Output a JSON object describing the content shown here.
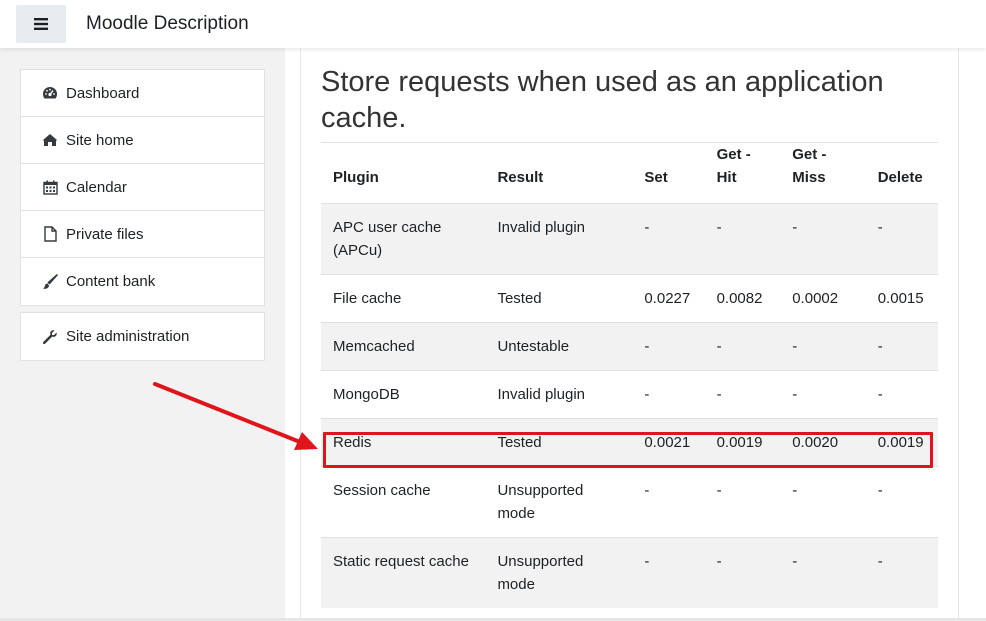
{
  "navbar": {
    "menu_icon": "hamburger-icon",
    "site_name": "Moodle Description"
  },
  "nav": {
    "primary": [
      {
        "label": "Dashboard",
        "icon": "tachometer-icon"
      },
      {
        "label": "Site home",
        "icon": "home-icon"
      },
      {
        "label": "Calendar",
        "icon": "calendar-icon"
      },
      {
        "label": "Private files",
        "icon": "file-icon"
      },
      {
        "label": "Content bank",
        "icon": "paintbrush-icon"
      }
    ],
    "secondary": [
      {
        "label": "Site administration",
        "icon": "wrench-icon"
      }
    ]
  },
  "main": {
    "heading": "Store requests when used as an application cache.",
    "table": {
      "headers": {
        "plugin": "Plugin",
        "result": "Result",
        "set": "Set",
        "get_hit_1": "Get -",
        "get_hit_2": "Hit",
        "get_miss_1": "Get -",
        "get_miss_2": "Miss",
        "delete": "Delete"
      },
      "rows": [
        {
          "plugin": "APC user cache (APCu)",
          "result": "Invalid plugin",
          "set": "-",
          "get_hit": "-",
          "get_miss": "-",
          "delete": "-"
        },
        {
          "plugin": "File cache",
          "result": "Tested",
          "set": "0.0227",
          "get_hit": "0.0082",
          "get_miss": "0.0002",
          "delete": "0.0015"
        },
        {
          "plugin": "Memcached",
          "result": "Untestable",
          "set": "-",
          "get_hit": "-",
          "get_miss": "-",
          "delete": "-"
        },
        {
          "plugin": "MongoDB",
          "result": "Invalid plugin",
          "set": "-",
          "get_hit": "-",
          "get_miss": "-",
          "delete": "-"
        },
        {
          "plugin": "Redis",
          "result": "Tested",
          "set": "0.0021",
          "get_hit": "0.0019",
          "get_miss": "0.0020",
          "delete": "0.0019"
        },
        {
          "plugin": "Session cache",
          "result": "Unsupported mode",
          "set": "-",
          "get_hit": "-",
          "get_miss": "-",
          "delete": "-"
        },
        {
          "plugin": "Static request cache",
          "result": "Unsupported mode",
          "set": "-",
          "get_hit": "-",
          "get_miss": "-",
          "delete": "-"
        }
      ]
    }
  },
  "annotation": {
    "color": "#e0141b",
    "highlighted_row": "Redis"
  }
}
